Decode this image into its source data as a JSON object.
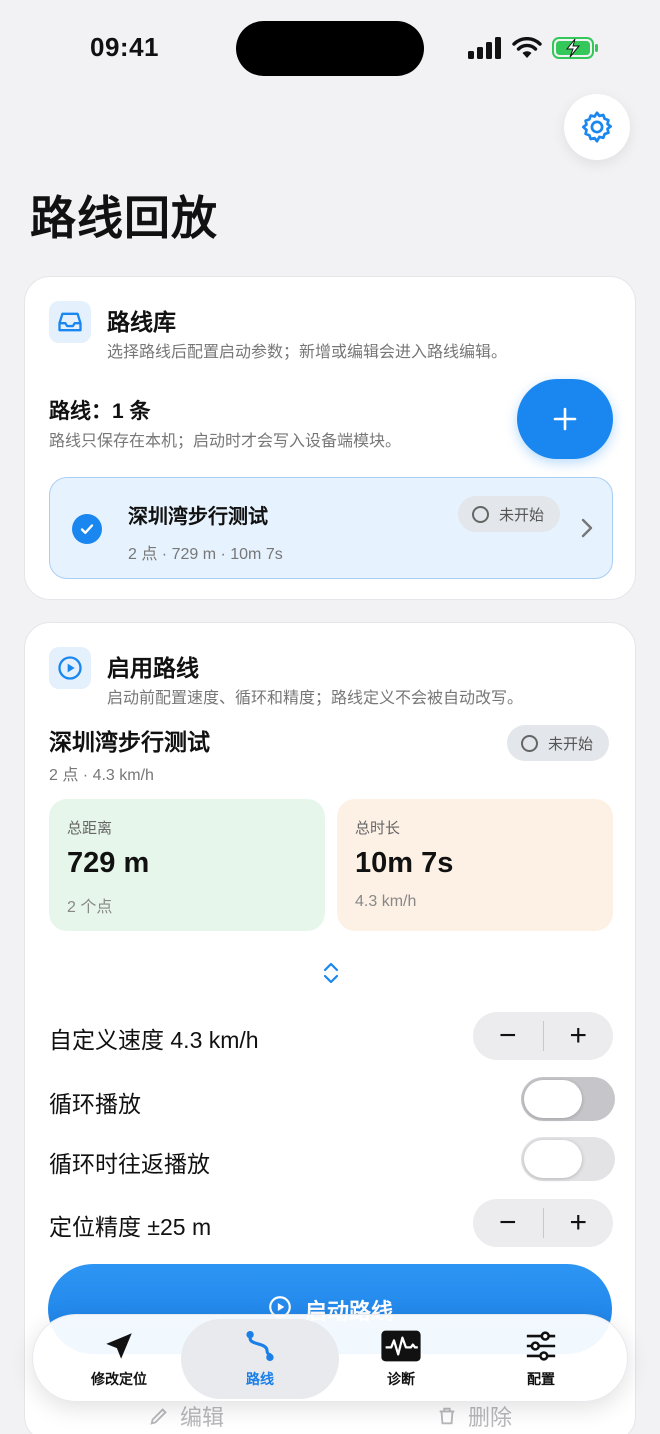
{
  "status_bar": {
    "time": "09:41"
  },
  "page": {
    "title": "路线回放"
  },
  "library": {
    "title": "路线库",
    "subtitle": "选择路线后配置启动参数；新增或编辑会进入路线编辑。",
    "count_label": "路线：1 条",
    "note": "路线只保存在本机；启动时才会写入设备端模块。",
    "add_label": "+",
    "routes": [
      {
        "name": "深圳湾步行测试",
        "meta": "2 点 · 729 m · 10m 7s",
        "status": "未开始",
        "selected": true
      }
    ]
  },
  "enable": {
    "title": "启用路线",
    "subtitle": "启动前配置速度、循环和精度；路线定义不会被自动改写。",
    "route_name": "深圳湾步行测试",
    "route_meta": "2 点 · 4.3 km/h",
    "status": "未开始",
    "stats": [
      {
        "label": "总距离",
        "value": "729 m",
        "sub": "2 个点"
      },
      {
        "label": "总时长",
        "value": "10m 7s",
        "sub": "4.3 km/h"
      }
    ],
    "speed_label": "自定义速度 4.3 km/h",
    "loop_label": "循环播放",
    "pingpong_label": "循环时往返播放",
    "accuracy_label": "定位精度 ±25 m",
    "minus": "−",
    "plus": "+",
    "start_label": "启动路线",
    "edit_label": "编辑",
    "delete_label": "删除"
  },
  "tabs": [
    {
      "label": "修改定位",
      "icon": "location-arrow-icon"
    },
    {
      "label": "路线",
      "icon": "route-icon",
      "active": true
    },
    {
      "label": "诊断",
      "icon": "pulse-icon"
    },
    {
      "label": "配置",
      "icon": "sliders-icon"
    }
  ],
  "colors": {
    "accent": "#1a87f0",
    "green_tile": "#e7f6ea",
    "orange_tile": "#fdf1e6"
  }
}
